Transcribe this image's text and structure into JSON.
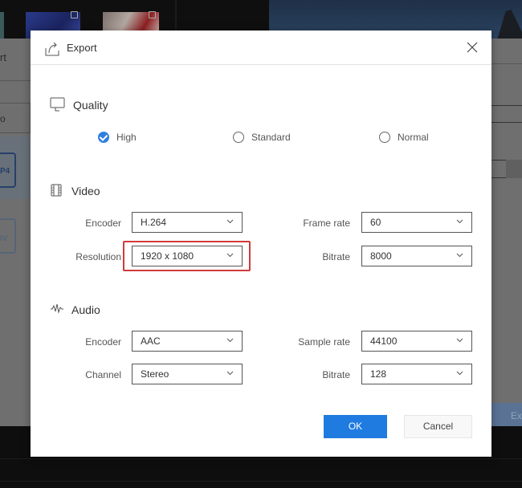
{
  "background": {
    "left_panel_label": "rt",
    "left_box_label": "o",
    "formats": [
      {
        "label": "P4",
        "icon": "mp4-file-icon"
      },
      {
        "label": "IV",
        "icon": "flv-file-icon"
      }
    ],
    "export_button_label": "Exp"
  },
  "dialog": {
    "title": "Export",
    "title_icon": "export-icon",
    "close_icon": "close-icon",
    "quality": {
      "title": "Quality",
      "icon": "monitor-icon",
      "options": [
        {
          "label": "High",
          "selected": true
        },
        {
          "label": "Standard",
          "selected": false
        },
        {
          "label": "Normal",
          "selected": false
        }
      ]
    },
    "video": {
      "title": "Video",
      "icon": "film-icon",
      "fields": {
        "encoder": {
          "label": "Encoder",
          "value": "H.264"
        },
        "resolution": {
          "label": "Resolution",
          "value": "1920 x 1080",
          "highlighted": true
        },
        "frame_rate": {
          "label": "Frame rate",
          "value": "60"
        },
        "bitrate": {
          "label": "Bitrate",
          "value": "8000"
        }
      }
    },
    "audio": {
      "title": "Audio",
      "icon": "waveform-icon",
      "fields": {
        "encoder": {
          "label": "Encoder",
          "value": "AAC"
        },
        "channel": {
          "label": "Channel",
          "value": "Stereo"
        },
        "sample_rate": {
          "label": "Sample rate",
          "value": "44100"
        },
        "bitrate": {
          "label": "Bitrate",
          "value": "128"
        }
      }
    },
    "buttons": {
      "ok": "OK",
      "cancel": "Cancel"
    },
    "colors": {
      "accent": "#1f7be0",
      "highlight_border": "#d23a3a"
    }
  }
}
